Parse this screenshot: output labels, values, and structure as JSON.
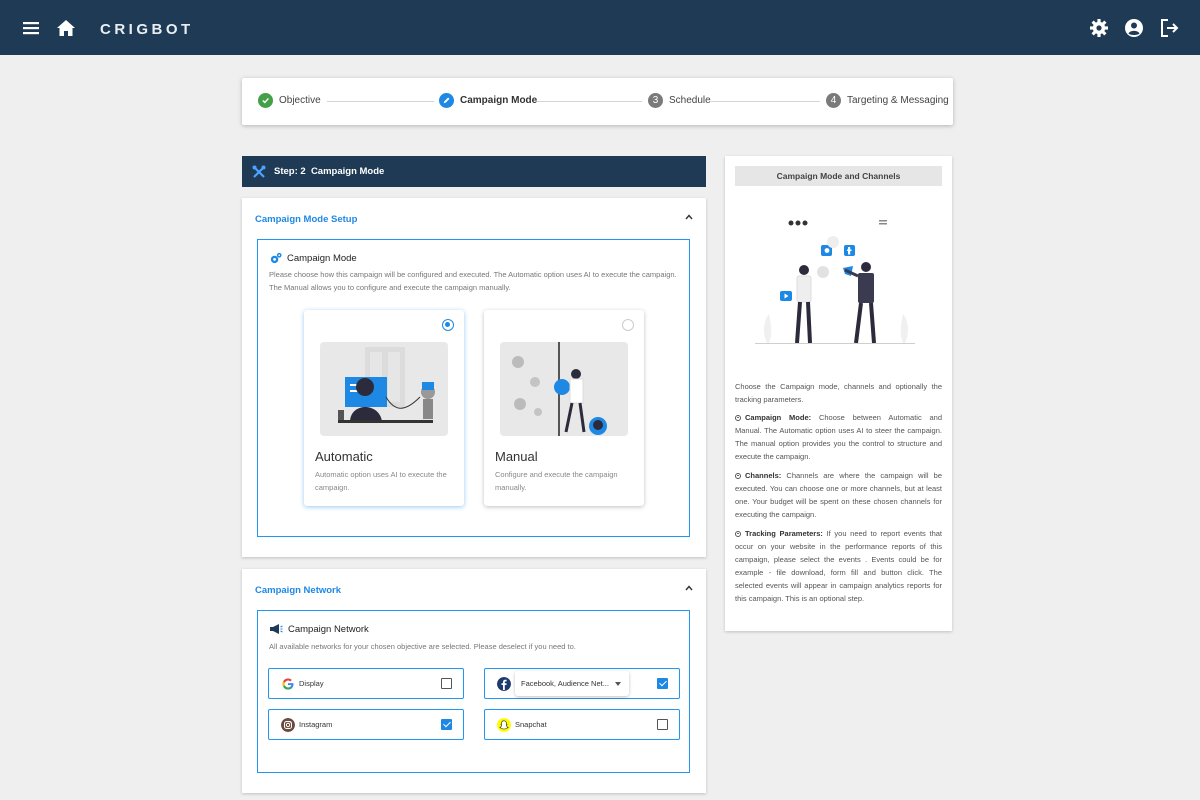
{
  "app": {
    "brand": "CRIGBOT"
  },
  "header_icons": [
    "menu-icon",
    "home-icon",
    "gear-icon",
    "account-icon",
    "logout-icon"
  ],
  "stepper": {
    "steps": [
      {
        "label": "Objective",
        "status": "done",
        "marker": ""
      },
      {
        "label": "Campaign Mode",
        "status": "active",
        "marker": ""
      },
      {
        "label": "Schedule",
        "status": "todo",
        "marker": "3"
      },
      {
        "label": "Targeting & Messaging",
        "status": "todo",
        "marker": "4"
      }
    ]
  },
  "step_header": {
    "title": "Step: 2  Campaign Mode"
  },
  "mode_setup": {
    "card_title": "Campaign Mode Setup",
    "box_title": "Campaign Mode",
    "description": "Please choose how this campaign will be configured and executed. The Automatic option uses AI to execute the campaign. The Manual allows you to configure and execute the campaign manually.",
    "options": [
      {
        "title": "Automatic",
        "description": "Automatic option uses AI to execute the campaign.",
        "selected": true
      },
      {
        "title": "Manual",
        "description": "Configure and execute the campaign manually.",
        "selected": false
      }
    ]
  },
  "network": {
    "card_title": "Campaign Network",
    "box_title": "Campaign Network",
    "description": "All available networks for your chosen objective are selected. Please deselect if you need to.",
    "items": [
      {
        "label": "Display",
        "icon": "google-icon",
        "checked": false
      },
      {
        "label": "Facebook, Audience Net...",
        "icon": "facebook-icon",
        "checked": true,
        "dropdown": true
      },
      {
        "label": "Instagram",
        "icon": "instagram-icon",
        "checked": true
      },
      {
        "label": "Snapchat",
        "icon": "snapchat-icon",
        "checked": false
      }
    ]
  },
  "side_panel": {
    "title": "Campaign Mode and Channels",
    "intro": "Choose the Campaign mode, channels and optionally the tracking parameters.",
    "sections": [
      {
        "term": "Campaign Mode:",
        "text": "Choose between Automatic and Manual. The Automatic option uses AI to steer the campaign. The manual option provides you the control to structure and execute the campaign."
      },
      {
        "term": "Channels:",
        "text": "Channels are where the campaign will be executed. You can choose one or more channels, but at least one. Your budget will be spent on these chosen channels for executing the campaign."
      },
      {
        "term": "Tracking Parameters:",
        "text": "If you need to report events that occur on your website in the performance reports of this campaign, please select the events . Events could be for example - file download, form fill and button click. The selected events will appear in campaign analytics reports for this campaign. This is an optional step."
      }
    ]
  },
  "colors": {
    "navbar": "#1f3a54",
    "accent": "#1e88e5",
    "done": "#43a047",
    "page_bg": "#efefef"
  }
}
